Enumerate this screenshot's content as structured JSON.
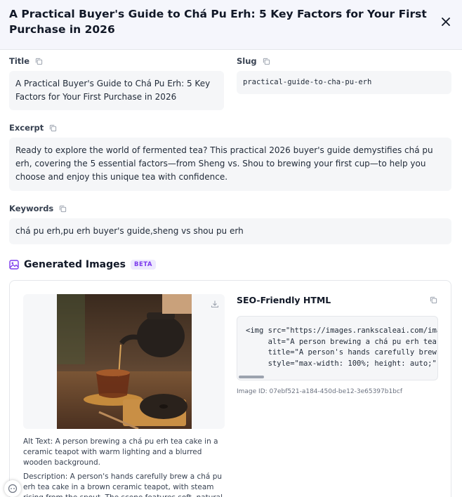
{
  "header": {
    "title": "A Practical Buyer's Guide to Chá Pu Erh: 5 Key Factors for Your First Purchase in 2026"
  },
  "fields": {
    "title": {
      "label": "Title",
      "value": "A Practical Buyer's Guide to Chá Pu Erh: 5 Key Factors for Your First Purchase in 2026"
    },
    "slug": {
      "label": "Slug",
      "value": "practical-guide-to-cha-pu-erh"
    },
    "excerpt": {
      "label": "Excerpt",
      "value": "Ready to explore the world of fermented tea? This practical 2026 buyer's guide demystifies chá pu erh, covering the 5 essential factors—from Sheng vs. Shou to brewing your first cup—to help you choose and enjoy this unique tea with confidence."
    },
    "keywords": {
      "label": "Keywords",
      "value": "chá pu erh,pu erh buyer's guide,sheng vs shou pu erh"
    }
  },
  "images_section": {
    "title": "Generated Images",
    "badge": "BETA",
    "alt_text": "Alt Text: A person brewing a chá pu erh tea cake in a ceramic teapot with warm lighting and a blurred wooden background.",
    "description": "Description: A person's hands carefully brew a chá pu erh tea cake in a brown ceramic teapot, with steam rising from the spout. The scene features soft, natural lighting.",
    "seo_html_title": "SEO-Friendly HTML",
    "seo_html_code": "<img src=\"https://images.rankscaleai.com/images/\n     alt=\"A person brewing a chá pu erh tea cake\n     title=\"A person's hands carefully brew a ch\n     style=\"max-width: 100%; height: auto;\" />",
    "image_id": "Image ID: 07ebf521-a184-450d-be12-3e65397b1bcf"
  },
  "colors": {
    "accent": "#7c3aed",
    "header_bg": "#f5f6fc",
    "field_bg": "#f5f6f8"
  }
}
